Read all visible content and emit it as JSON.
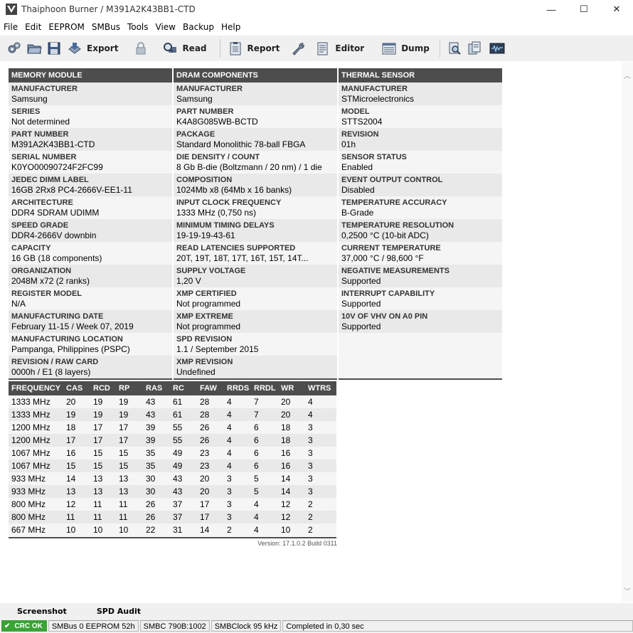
{
  "window": {
    "title": "Thaiphoon Burner / M391A2K43BB1-CTD",
    "controls": {
      "minimize": "—",
      "maximize": "☐",
      "close": "✕"
    }
  },
  "menu": [
    "File",
    "Edit",
    "EEPROM",
    "SMBus",
    "Tools",
    "View",
    "Backup",
    "Help"
  ],
  "toolbar": {
    "export_label": "Export",
    "read_label": "Read",
    "report_label": "Report",
    "editor_label": "Editor",
    "dump_label": "Dump"
  },
  "spd": {
    "memory_module": {
      "header": "MEMORY MODULE",
      "rows": [
        {
          "label": "MANUFACTURER",
          "value": "Samsung"
        },
        {
          "label": "SERIES",
          "value": "Not determined"
        },
        {
          "label": "PART NUMBER",
          "value": "M391A2K43BB1-CTD"
        },
        {
          "label": "SERIAL NUMBER",
          "value": "K0YO00090724F2FC99"
        },
        {
          "label": "JEDEC DIMM LABEL",
          "value": "16GB 2Rx8 PC4-2666V-EE1-11"
        },
        {
          "label": "ARCHITECTURE",
          "value": "DDR4 SDRAM UDIMM"
        },
        {
          "label": "SPEED GRADE",
          "value": "DDR4-2666V downbin"
        },
        {
          "label": "CAPACITY",
          "value": "16 GB (18 components)"
        },
        {
          "label": "ORGANIZATION",
          "value": "2048M x72 (2 ranks)"
        },
        {
          "label": "REGISTER MODEL",
          "value": "N/A"
        },
        {
          "label": "MANUFACTURING DATE",
          "value": "February 11-15 / Week 07, 2019"
        },
        {
          "label": "MANUFACTURING LOCATION",
          "value": "Pampanga, Philippines (PSPC)"
        },
        {
          "label": "REVISION / RAW CARD",
          "value": "0000h / E1 (8 layers)"
        }
      ]
    },
    "dram_components": {
      "header": "DRAM COMPONENTS",
      "rows": [
        {
          "label": "MANUFACTURER",
          "value": "Samsung"
        },
        {
          "label": "PART NUMBER",
          "value": "K4A8G085WB-BCTD"
        },
        {
          "label": "PACKAGE",
          "value": "Standard Monolithic 78-ball FBGA"
        },
        {
          "label": "DIE DENSITY / COUNT",
          "value": "8 Gb B-die (Boltzmann / 20 nm) / 1 die"
        },
        {
          "label": "COMPOSITION",
          "value": "1024Mb x8 (64Mb x 16 banks)"
        },
        {
          "label": "INPUT CLOCK FREQUENCY",
          "value": "1333 MHz (0,750 ns)"
        },
        {
          "label": "MINIMUM TIMING DELAYS",
          "value": "19-19-19-43-61"
        },
        {
          "label": "READ LATENCIES SUPPORTED",
          "value": "20T, 19T, 18T, 17T, 16T, 15T, 14T..."
        },
        {
          "label": "SUPPLY VOLTAGE",
          "value": "1,20 V"
        },
        {
          "label": "XMP CERTIFIED",
          "value": "Not programmed"
        },
        {
          "label": "XMP EXTREME",
          "value": "Not programmed"
        },
        {
          "label": "SPD REVISION",
          "value": "1.1 / September 2015"
        },
        {
          "label": "XMP REVISION",
          "value": "Undefined"
        }
      ]
    },
    "thermal_sensor": {
      "header": "THERMAL SENSOR",
      "rows": [
        {
          "label": "MANUFACTURER",
          "value": "STMicroelectronics"
        },
        {
          "label": "MODEL",
          "value": "STTS2004"
        },
        {
          "label": "REVISION",
          "value": "01h"
        },
        {
          "label": "SENSOR STATUS",
          "value": "Enabled"
        },
        {
          "label": "EVENT OUTPUT CONTROL",
          "value": "Disabled"
        },
        {
          "label": "TEMPERATURE ACCURACY",
          "value": "B-Grade"
        },
        {
          "label": "TEMPERATURE RESOLUTION",
          "value": "0,2500 °C (10-bit ADC)"
        },
        {
          "label": "CURRENT TEMPERATURE",
          "value": "37,000 °C / 98,600 °F"
        },
        {
          "label": "NEGATIVE MEASUREMENTS",
          "value": "Supported"
        },
        {
          "label": "INTERRUPT CAPABILITY",
          "value": "Supported"
        },
        {
          "label": "10V OF VHV ON A0 PIN",
          "value": "Supported"
        }
      ]
    }
  },
  "timings": {
    "headers": [
      "FREQUENCY",
      "CAS",
      "RCD",
      "RP",
      "RAS",
      "RC",
      "FAW",
      "RRDS",
      "RRDL",
      "WR",
      "WTRS"
    ],
    "rows": [
      [
        "1333 MHz",
        "20",
        "19",
        "19",
        "43",
        "61",
        "28",
        "4",
        "7",
        "20",
        "4"
      ],
      [
        "1333 MHz",
        "19",
        "19",
        "19",
        "43",
        "61",
        "28",
        "4",
        "7",
        "20",
        "4"
      ],
      [
        "1200 MHz",
        "18",
        "17",
        "17",
        "39",
        "55",
        "26",
        "4",
        "6",
        "18",
        "3"
      ],
      [
        "1200 MHz",
        "17",
        "17",
        "17",
        "39",
        "55",
        "26",
        "4",
        "6",
        "18",
        "3"
      ],
      [
        "1067 MHz",
        "16",
        "15",
        "15",
        "35",
        "49",
        "23",
        "4",
        "6",
        "16",
        "3"
      ],
      [
        "1067 MHz",
        "15",
        "15",
        "15",
        "35",
        "49",
        "23",
        "4",
        "6",
        "16",
        "3"
      ],
      [
        "933 MHz",
        "14",
        "13",
        "13",
        "30",
        "43",
        "20",
        "3",
        "5",
        "14",
        "3"
      ],
      [
        "933 MHz",
        "13",
        "13",
        "13",
        "30",
        "43",
        "20",
        "3",
        "5",
        "14",
        "3"
      ],
      [
        "800 MHz",
        "12",
        "11",
        "11",
        "26",
        "37",
        "17",
        "3",
        "4",
        "12",
        "2"
      ],
      [
        "800 MHz",
        "11",
        "11",
        "11",
        "26",
        "37",
        "17",
        "3",
        "4",
        "12",
        "2"
      ],
      [
        "667 MHz",
        "10",
        "10",
        "10",
        "22",
        "31",
        "14",
        "2",
        "4",
        "10",
        "2"
      ]
    ]
  },
  "version": "Version: 17.1.0.2 Build 0311",
  "tabs": [
    "Screenshot",
    "SPD Audit"
  ],
  "status": {
    "crc": "CRC OK",
    "smbus": "SMBus 0 EEPROM 52h",
    "smbc": "SMBC 790B:1002",
    "smbclock": "SMBClock 95 kHz",
    "completed": "Completed in 0,30 sec"
  },
  "colors": {
    "header_bg": "#4d4d4d",
    "row_dark": "#e9e9e9",
    "row_light": "#f5f5f5",
    "crc_ok": "#3aa335"
  }
}
